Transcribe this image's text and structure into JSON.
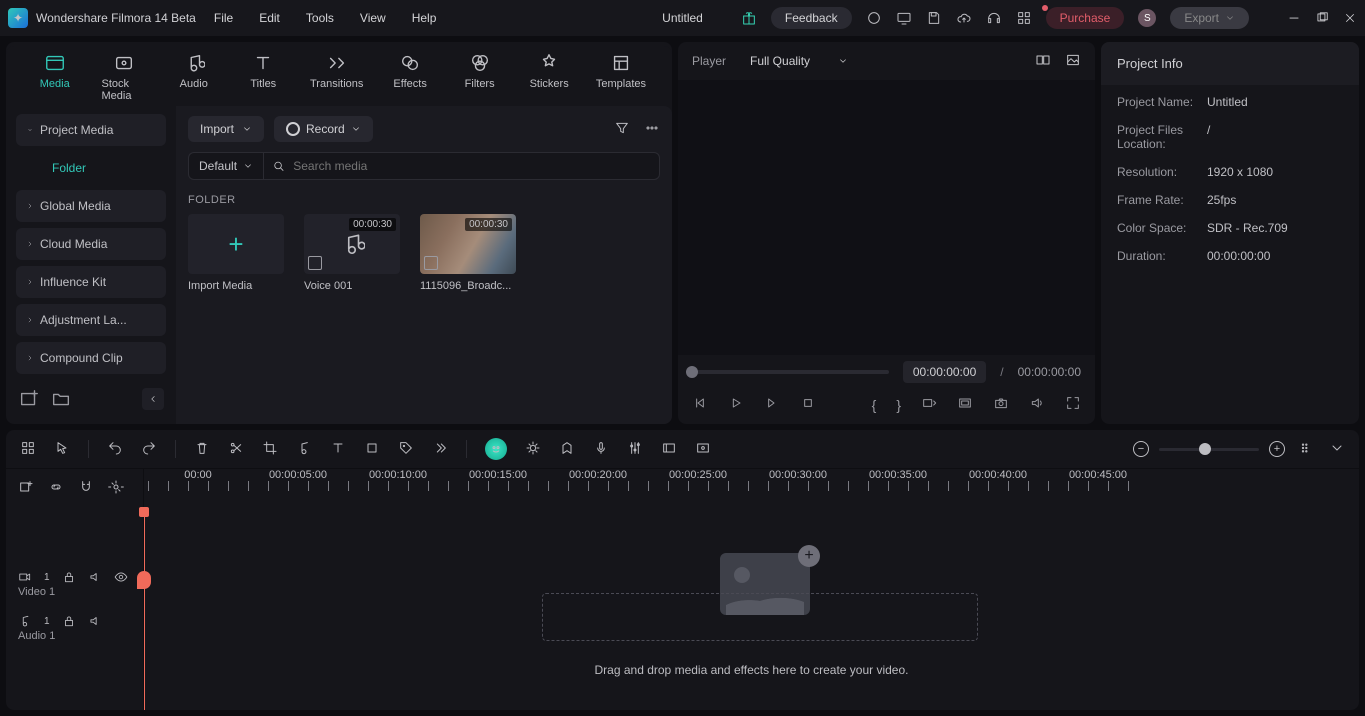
{
  "app": {
    "name": "Wondershare Filmora 14 Beta",
    "doc_title": "Untitled"
  },
  "menu": [
    "File",
    "Edit",
    "Tools",
    "View",
    "Help"
  ],
  "titlebar": {
    "feedback": "Feedback",
    "purchase": "Purchase",
    "export": "Export",
    "avatar_initial": "S"
  },
  "tabs": [
    {
      "id": "media",
      "label": "Media"
    },
    {
      "id": "stock",
      "label": "Stock Media"
    },
    {
      "id": "audio",
      "label": "Audio"
    },
    {
      "id": "titles",
      "label": "Titles"
    },
    {
      "id": "transitions",
      "label": "Transitions"
    },
    {
      "id": "effects",
      "label": "Effects"
    },
    {
      "id": "filters",
      "label": "Filters"
    },
    {
      "id": "stickers",
      "label": "Stickers"
    },
    {
      "id": "templates",
      "label": "Templates"
    }
  ],
  "sidenav": {
    "project_media": "Project Media",
    "folder": "Folder",
    "global_media": "Global Media",
    "cloud_media": "Cloud Media",
    "influence_kit": "Influence Kit",
    "adjustment": "Adjustment La...",
    "compound": "Compound Clip"
  },
  "media_toolbar": {
    "import": "Import",
    "record": "Record",
    "default": "Default",
    "search_placeholder": "Search media"
  },
  "folder_label": "FOLDER",
  "thumbs": {
    "import": "Import Media",
    "voice": {
      "label": "Voice 001",
      "dur": "00:00:30"
    },
    "clip": {
      "label": "1115096_Broadc...",
      "dur": "00:00:30"
    }
  },
  "player": {
    "label": "Player",
    "quality": "Full Quality",
    "current": "00:00:00:00",
    "total": "00:00:00:00"
  },
  "info": {
    "header": "Project Info",
    "rows": {
      "name_k": "Project Name:",
      "name_v": "Untitled",
      "loc_k": "Project Files Location:",
      "loc_v": "/",
      "res_k": "Resolution:",
      "res_v": "1920 x 1080",
      "fps_k": "Frame Rate:",
      "fps_v": "25fps",
      "cs_k": "Color Space:",
      "cs_v": "SDR - Rec.709",
      "dur_k": "Duration:",
      "dur_v": "00:00:00:00"
    }
  },
  "timeline": {
    "marks": [
      "00:00",
      "00:00:05:00",
      "00:00:10:00",
      "00:00:15:00",
      "00:00:20:00",
      "00:00:25:00",
      "00:00:30:00",
      "00:00:35:00",
      "00:00:40:00",
      "00:00:45:00"
    ],
    "drop_text": "Drag and drop media and effects here to create your video.",
    "video_track": "Video 1",
    "audio_track": "Audio 1"
  }
}
